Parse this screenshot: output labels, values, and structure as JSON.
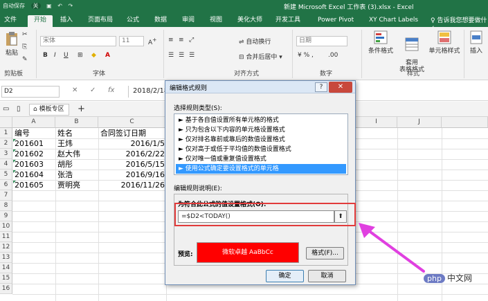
{
  "title_bar": {
    "autosave": "自动保存",
    "autosave_state": "关",
    "title": "新建 Microsoft Excel 工作表 (3).xlsx  -  Excel"
  },
  "tabs": [
    "文件",
    "开始",
    "插入",
    "页面布局",
    "公式",
    "数据",
    "审阅",
    "视图",
    "美化大师",
    "开发工具",
    "Power Pivot",
    "XY Chart Labels"
  ],
  "tell_me": "告诉我您想要做什么",
  "ribbon": {
    "clipboard": {
      "paste": "粘贴",
      "label": "剪贴板"
    },
    "font": {
      "name": "宋体",
      "size": "11",
      "bold": "B",
      "italic": "I",
      "underline": "U",
      "label": "字体"
    },
    "alignment": {
      "wrap": "自动换行",
      "merge": "合并后居中",
      "label": "对齐方式"
    },
    "number": {
      "format": "日期",
      "label": "数字"
    },
    "styles": {
      "conditional": "条件格式",
      "table": "套用\n表格格式",
      "cell": "单元格样式",
      "label": "样式"
    },
    "cells": {
      "insert": "插入"
    }
  },
  "formula_bar": {
    "name_box": "D2",
    "cancel": "✕",
    "enter": "✓",
    "fx": "fx",
    "value": "2018/2/18"
  },
  "file_tab": "模板专区",
  "columns": [
    "A",
    "B",
    "C",
    "",
    "",
    "",
    "",
    "",
    "I",
    "J"
  ],
  "rows": [
    "1",
    "2",
    "3",
    "4",
    "5",
    "6",
    "7",
    "8",
    "9",
    "10",
    "11",
    "12",
    "13",
    "14",
    "15",
    "16"
  ],
  "table": {
    "headers": [
      "编号",
      "姓名",
      "合同签订日期"
    ],
    "data": [
      [
        "201601",
        "王炜",
        "2016/1/5"
      ],
      [
        "201602",
        "赵大伟",
        "2016/2/22"
      ],
      [
        "201603",
        "胡彤",
        "2016/5/15"
      ],
      [
        "201604",
        "张浩",
        "2016/9/16"
      ],
      [
        "201605",
        "贾明亮",
        "2016/11/26"
      ]
    ]
  },
  "dialog": {
    "title": "编辑格式规则",
    "help": "?",
    "close": "✕",
    "select_rule_type": "选择规则类型(S):",
    "rule_types": [
      "► 基于各自值设置所有单元格的格式",
      "► 只为包含以下内容的单元格设置格式",
      "► 仅对排名靠前或靠后的数值设置格式",
      "► 仅对高于或低于平均值的数值设置格式",
      "► 仅对唯一值或重复值设置格式",
      "► 使用公式确定要设置格式的单元格"
    ],
    "selected_index": 5,
    "edit_rule_desc": "编辑规则说明(E):",
    "formula_label": "为符合此公式的值设置格式(O):",
    "formula_value": "=$D2<TODAY()",
    "collapse": "⬆",
    "preview_label": "预览:",
    "preview_text": "微软卓越  AaBbCc",
    "preview_color": "#ff0000",
    "format_button": "格式(F)...",
    "ok": "确定",
    "cancel": "取消"
  },
  "watermark": {
    "badge": "php",
    "text": "中文网"
  }
}
